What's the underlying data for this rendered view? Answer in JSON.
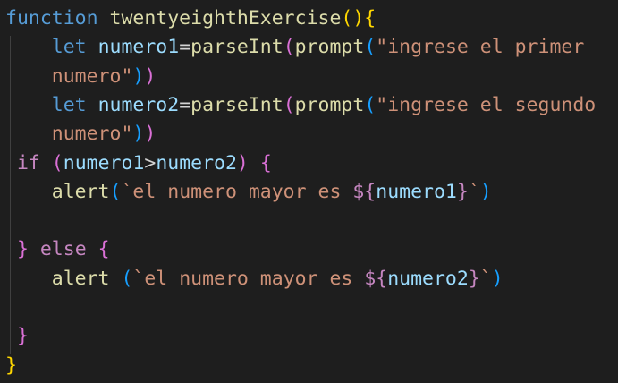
{
  "editor": {
    "colors": {
      "background": "#1e1e1e",
      "keyword": "#569cd6",
      "control": "#c586c0",
      "function": "#dcdcaa",
      "variable": "#9cdcfe",
      "string": "#ce9178",
      "bracket_level1": "#ffd700",
      "bracket_level2": "#da70d6",
      "bracket_level3": "#179fff"
    },
    "lines": [
      [
        {
          "t": "function",
          "c": "keyword"
        },
        {
          "t": " ",
          "c": "op"
        },
        {
          "t": "twentyeighthExercise",
          "c": "func"
        },
        {
          "t": "()",
          "c": "b1"
        },
        {
          "t": "{",
          "c": "b1"
        }
      ],
      [
        {
          "t": "    ",
          "c": "op"
        },
        {
          "t": "let",
          "c": "keyword"
        },
        {
          "t": " ",
          "c": "op"
        },
        {
          "t": "numero1",
          "c": "var"
        },
        {
          "t": "=",
          "c": "op"
        },
        {
          "t": "parseInt",
          "c": "func"
        },
        {
          "t": "(",
          "c": "b2"
        },
        {
          "t": "prompt",
          "c": "func"
        },
        {
          "t": "(",
          "c": "b3"
        },
        {
          "t": "\"ingrese el primer",
          "c": "string"
        }
      ],
      [
        {
          "t": "    ",
          "c": "op"
        },
        {
          "t": "numero\"",
          "c": "string"
        },
        {
          "t": ")",
          "c": "b3"
        },
        {
          "t": ")",
          "c": "b2"
        }
      ],
      [
        {
          "t": "    ",
          "c": "op"
        },
        {
          "t": "let",
          "c": "keyword"
        },
        {
          "t": " ",
          "c": "op"
        },
        {
          "t": "numero2",
          "c": "var"
        },
        {
          "t": "=",
          "c": "op"
        },
        {
          "t": "parseInt",
          "c": "func"
        },
        {
          "t": "(",
          "c": "b2"
        },
        {
          "t": "prompt",
          "c": "func"
        },
        {
          "t": "(",
          "c": "b3"
        },
        {
          "t": "\"ingrese el segundo",
          "c": "string"
        }
      ],
      [
        {
          "t": "    ",
          "c": "op"
        },
        {
          "t": "numero\"",
          "c": "string"
        },
        {
          "t": ")",
          "c": "b3"
        },
        {
          "t": ")",
          "c": "b2"
        }
      ],
      [
        {
          "t": " ",
          "c": "op"
        },
        {
          "t": "if",
          "c": "control"
        },
        {
          "t": " ",
          "c": "op"
        },
        {
          "t": "(",
          "c": "b2"
        },
        {
          "t": "numero1",
          "c": "var"
        },
        {
          "t": ">",
          "c": "op"
        },
        {
          "t": "numero2",
          "c": "var"
        },
        {
          "t": ")",
          "c": "b2"
        },
        {
          "t": " ",
          "c": "op"
        },
        {
          "t": "{",
          "c": "b2"
        }
      ],
      [
        {
          "t": "    ",
          "c": "op"
        },
        {
          "t": "alert",
          "c": "func"
        },
        {
          "t": "(",
          "c": "b3"
        },
        {
          "t": "`el numero mayor es ",
          "c": "string"
        },
        {
          "t": "${",
          "c": "interp"
        },
        {
          "t": "numero1",
          "c": "var"
        },
        {
          "t": "}",
          "c": "interp"
        },
        {
          "t": "`",
          "c": "string"
        },
        {
          "t": ")",
          "c": "b3"
        }
      ],
      [],
      [
        {
          "t": " ",
          "c": "op"
        },
        {
          "t": "}",
          "c": "b2"
        },
        {
          "t": " ",
          "c": "op"
        },
        {
          "t": "else",
          "c": "control"
        },
        {
          "t": " ",
          "c": "op"
        },
        {
          "t": "{",
          "c": "b2"
        }
      ],
      [
        {
          "t": "    ",
          "c": "op"
        },
        {
          "t": "alert",
          "c": "func"
        },
        {
          "t": " ",
          "c": "op"
        },
        {
          "t": "(",
          "c": "b3"
        },
        {
          "t": "`el numero mayor es ",
          "c": "string"
        },
        {
          "t": "${",
          "c": "interp"
        },
        {
          "t": "numero2",
          "c": "var"
        },
        {
          "t": "}",
          "c": "interp"
        },
        {
          "t": "`",
          "c": "string"
        },
        {
          "t": ")",
          "c": "b3"
        }
      ],
      [],
      [
        {
          "t": " ",
          "c": "op"
        },
        {
          "t": "}",
          "c": "b2"
        }
      ],
      [
        {
          "t": "}",
          "c": "b1"
        }
      ]
    ]
  }
}
